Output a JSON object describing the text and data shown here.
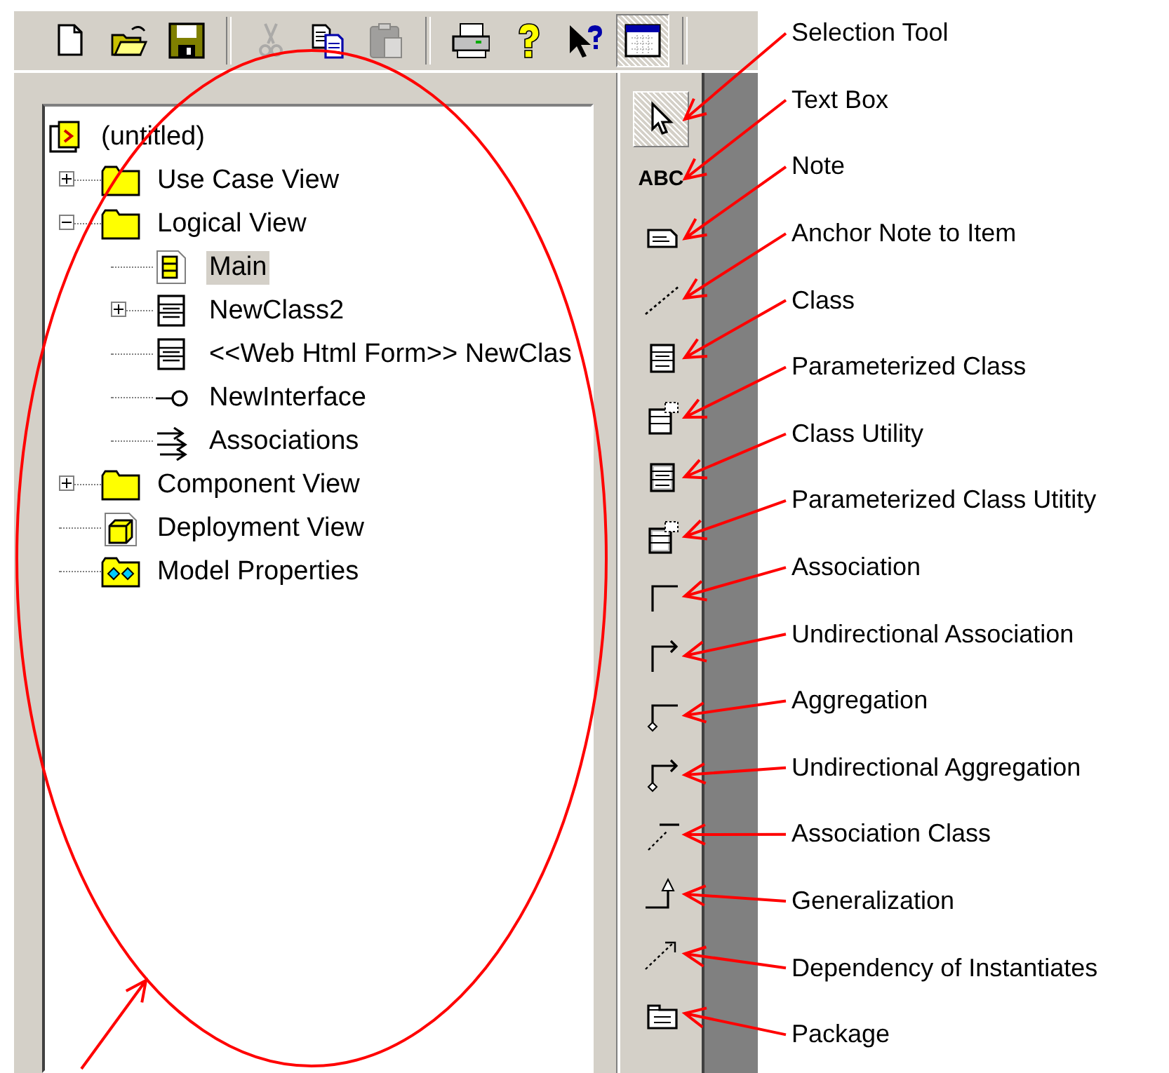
{
  "toolbar": [
    {
      "kind": "new",
      "disabled": false,
      "pressed": false
    },
    {
      "kind": "open",
      "disabled": false,
      "pressed": false
    },
    {
      "kind": "save",
      "disabled": false,
      "pressed": false
    },
    {
      "kind": "separator"
    },
    {
      "kind": "cut",
      "disabled": true,
      "pressed": false
    },
    {
      "kind": "copy",
      "disabled": false,
      "pressed": false
    },
    {
      "kind": "paste",
      "disabled": true,
      "pressed": false
    },
    {
      "kind": "separator"
    },
    {
      "kind": "print",
      "disabled": false,
      "pressed": false
    },
    {
      "kind": "help",
      "disabled": false,
      "pressed": false
    },
    {
      "kind": "context-help",
      "disabled": false,
      "pressed": false
    },
    {
      "kind": "browser",
      "disabled": false,
      "pressed": true
    },
    {
      "kind": "separator"
    }
  ],
  "tree": {
    "label": "(untitled)",
    "kind": "model",
    "selected": false,
    "children": [
      {
        "label": "Use Case View",
        "kind": "folder",
        "selected": false,
        "expanded": false
      },
      {
        "label": "Logical View",
        "kind": "folder",
        "selected": false,
        "expanded": true,
        "children": [
          {
            "label": "Main",
            "kind": "diagram",
            "selected": true
          },
          {
            "label": "NewClass2",
            "kind": "class",
            "selected": false,
            "expanded": false
          },
          {
            "label": "<<Web Html Form>> NewClas",
            "kind": "class",
            "selected": false
          },
          {
            "label": "NewInterface",
            "kind": "interface",
            "selected": false
          },
          {
            "label": "Associations",
            "kind": "associations",
            "selected": false
          }
        ]
      },
      {
        "label": "Component View",
        "kind": "folder",
        "selected": false,
        "expanded": false
      },
      {
        "label": "Deployment View",
        "kind": "deployment",
        "selected": false
      },
      {
        "label": "Model Properties",
        "kind": "properties",
        "selected": false
      }
    ]
  },
  "palette": [
    {
      "kind": "select",
      "selected": true
    },
    {
      "kind": "text",
      "selected": false,
      "glyph": "ABC"
    },
    {
      "kind": "note",
      "selected": false
    },
    {
      "kind": "anchor",
      "selected": false
    },
    {
      "kind": "class",
      "selected": false
    },
    {
      "kind": "param-class",
      "selected": false
    },
    {
      "kind": "utility",
      "selected": false
    },
    {
      "kind": "param-utility",
      "selected": false
    },
    {
      "kind": "association",
      "selected": false
    },
    {
      "kind": "uni-association",
      "selected": false
    },
    {
      "kind": "aggregation",
      "selected": false
    },
    {
      "kind": "uni-aggregation",
      "selected": false
    },
    {
      "kind": "association-class",
      "selected": false
    },
    {
      "kind": "generalization",
      "selected": false
    },
    {
      "kind": "dependency",
      "selected": false
    },
    {
      "kind": "package",
      "selected": false
    }
  ],
  "callouts": [
    "Selection Tool",
    "Text Box",
    "Note",
    "Anchor Note to Item",
    "Class",
    "Parameterized Class",
    "Class Utility",
    "Parameterized Class Utitity",
    "Association",
    "Undirectional Association",
    "Aggregation",
    "Undirectional Aggregation",
    "Association Class",
    "Generalization",
    "Dependency of Instantiates",
    "Package"
  ]
}
